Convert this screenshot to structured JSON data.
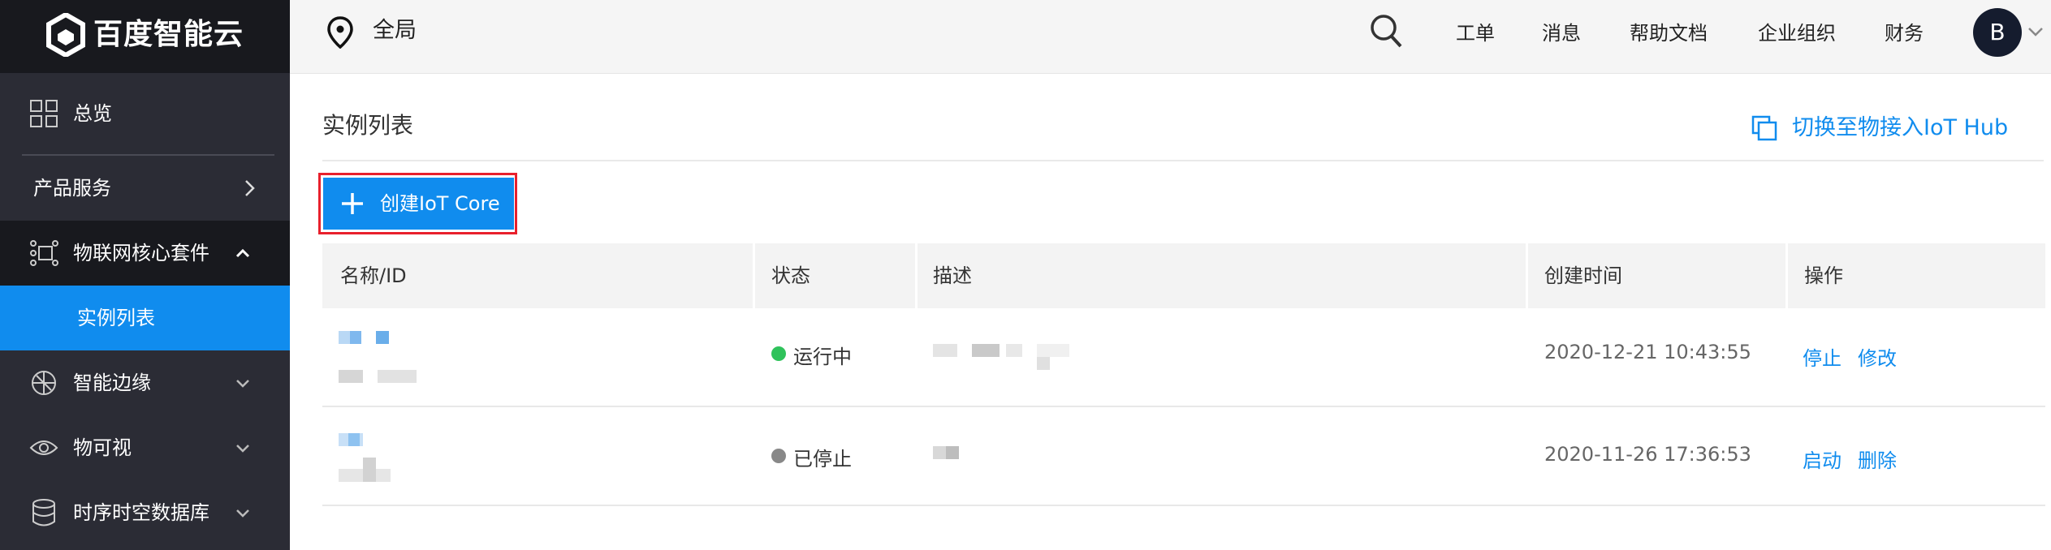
{
  "brand": {
    "name": "百度智能云"
  },
  "sidebar": {
    "overview": "总览",
    "products": "产品服务",
    "iot_core": "物联网核心套件",
    "instance_list": "实例列表",
    "edge": "智能边缘",
    "visual": "物可视",
    "tsdb": "时序时空数据库"
  },
  "topbar": {
    "region": "全局",
    "links": [
      "工单",
      "消息",
      "帮助文档",
      "企业组织",
      "财务"
    ],
    "avatar": "B"
  },
  "main": {
    "title": "实例列表",
    "switch_link": "切换至物接入IoT Hub",
    "create_button": "创建IoT Core"
  },
  "table": {
    "headers": [
      "名称/ID",
      "状态",
      "描述",
      "创建时间",
      "操作"
    ],
    "rows": [
      {
        "status": "运行中",
        "status_color": "#2fc25b",
        "created": "2020-12-21 10:43:55",
        "actions": [
          "停止",
          "修改"
        ]
      },
      {
        "status": "已停止",
        "status_color": "#888888",
        "created": "2020-11-26 17:36:53",
        "actions": [
          "启动",
          "删除"
        ]
      }
    ]
  },
  "colors": {
    "accent": "#108cee",
    "sidebar": "#2b2c35",
    "sidebar_dark": "#18191e",
    "highlight": "#e8202c"
  }
}
